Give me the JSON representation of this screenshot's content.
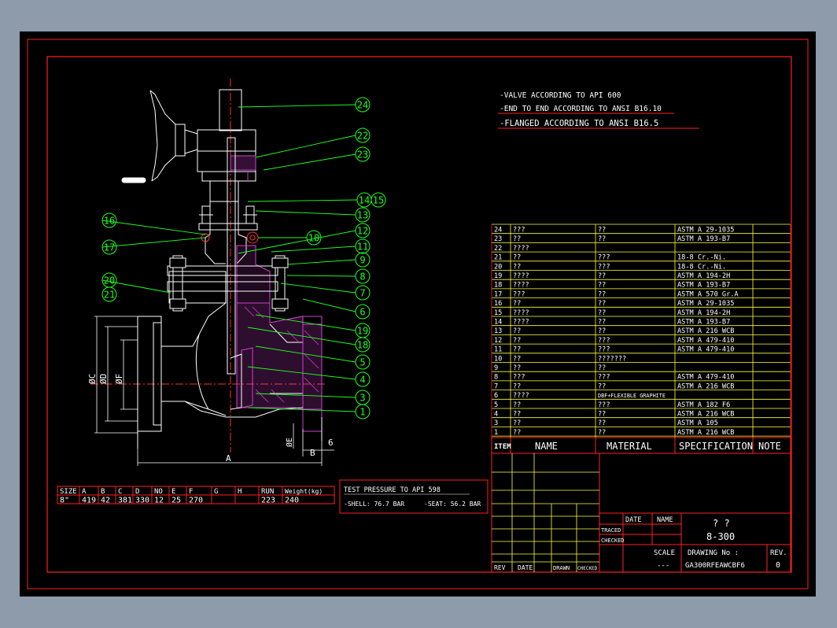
{
  "notes": [
    "-VALVE ACCORDING TO API 600",
    "-END TO END ACCORDING TO ANSI B16.10",
    "-FLANGED ACCORDING TO ANSI B16.5"
  ],
  "bom": [
    {
      "item": "24",
      "name": "???",
      "material": "??",
      "spec": "ASTM A 29-1035"
    },
    {
      "item": "23",
      "name": "??",
      "material": "??",
      "spec": "ASTM A 193-B7"
    },
    {
      "item": "22",
      "name": "????",
      "material": "",
      "spec": ""
    },
    {
      "item": "21",
      "name": "??",
      "material": "???",
      "spec": "18-8 Cr.-Ni."
    },
    {
      "item": "20",
      "name": "??",
      "material": "???",
      "spec": "18-8 Cr.-Ni."
    },
    {
      "item": "19",
      "name": "????",
      "material": "??",
      "spec": "ASTM A 194-2H"
    },
    {
      "item": "18",
      "name": "????",
      "material": "??",
      "spec": "ASTM A 193-B7"
    },
    {
      "item": "17",
      "name": "???",
      "material": "??",
      "spec": "ASTM A 570 Gr.A"
    },
    {
      "item": "16",
      "name": "??",
      "material": "??",
      "spec": "ASTM A 29-1035"
    },
    {
      "item": "15",
      "name": "????",
      "material": "??",
      "spec": "ASTM A 194-2H"
    },
    {
      "item": "14",
      "name": "????",
      "material": "??",
      "spec": "ASTM A 193-B7"
    },
    {
      "item": "13",
      "name": "??",
      "material": "??",
      "spec": "ASTM A 216 WCB"
    },
    {
      "item": "12",
      "name": "??",
      "material": "???",
      "spec": "ASTM A 479-410"
    },
    {
      "item": "11",
      "name": "??",
      "material": "???",
      "spec": "ASTM A 479-410"
    },
    {
      "item": "10",
      "name": "??",
      "material": "???????",
      "spec": ""
    },
    {
      "item": "9",
      "name": "??",
      "material": "??",
      "spec": ""
    },
    {
      "item": "8",
      "name": "???",
      "material": "???",
      "spec": "ASTM A 479-410"
    },
    {
      "item": "7",
      "name": "??",
      "material": "??",
      "spec": "ASTM A 216 WCB"
    },
    {
      "item": "6",
      "name": "????",
      "material": "DBF+FLEXIBLE GRAPHITE",
      "spec": ""
    },
    {
      "item": "5",
      "name": "??",
      "material": "???",
      "spec": "ASTM A 182 F6"
    },
    {
      "item": "4",
      "name": "??",
      "material": "??",
      "spec": "ASTM A 216 WCB"
    },
    {
      "item": "3",
      "name": "??",
      "material": "??",
      "spec": "ASTM A 105"
    },
    {
      "item": "1",
      "name": "??",
      "material": "??",
      "spec": "ASTM A 216 WCB"
    }
  ],
  "bom_header": {
    "item": "ITEM",
    "name": "NAME",
    "material": "MATERIAL",
    "spec": "SPECIFICATION",
    "note": "NOTE"
  },
  "title_block": {
    "date": "DATE",
    "name": "NAME",
    "traced": "TRACED",
    "checked": "CHECKED",
    "title_line1": "?  ?",
    "title_line2": "8-300",
    "scale_label": "SCALE",
    "scale_value": "---",
    "drawing_no_label": "DRAWING No :",
    "drawing_no": "GA300RFEAWCBF6",
    "rev_label": "REV.",
    "rev_value": "0",
    "rev_col": "REV",
    "date_col": "DATE",
    "drawn_col": "DRAWN",
    "checked_col": "CHECKED"
  },
  "size_table": {
    "headers": [
      "SIZE",
      "A",
      "B",
      "C",
      "D",
      "NO",
      "E",
      "F",
      "G",
      "H",
      "RUN",
      "Weight(kg)"
    ],
    "values": [
      "8\"",
      "419",
      "42",
      "381",
      "330",
      "12",
      "25",
      "270",
      "",
      "",
      "223",
      "240"
    ]
  },
  "test_pressure": {
    "title": "TEST PRESSURE TO API 598",
    "shell": "-SHELL: 76.7 BAR",
    "seat": "-SEAT: 56.2 BAR"
  },
  "dimensions": {
    "A": "A",
    "B": "B",
    "C": "ØC",
    "D": "ØD",
    "F": "ØF",
    "E": "ØE",
    "six": "6"
  },
  "balloons": [
    "24",
    "22",
    "23",
    "14",
    "15",
    "13",
    "12",
    "16",
    "17",
    "10",
    "11",
    "9",
    "8",
    "7",
    "20",
    "21",
    "6",
    "19",
    "18",
    "5",
    "4",
    "3",
    "1"
  ]
}
